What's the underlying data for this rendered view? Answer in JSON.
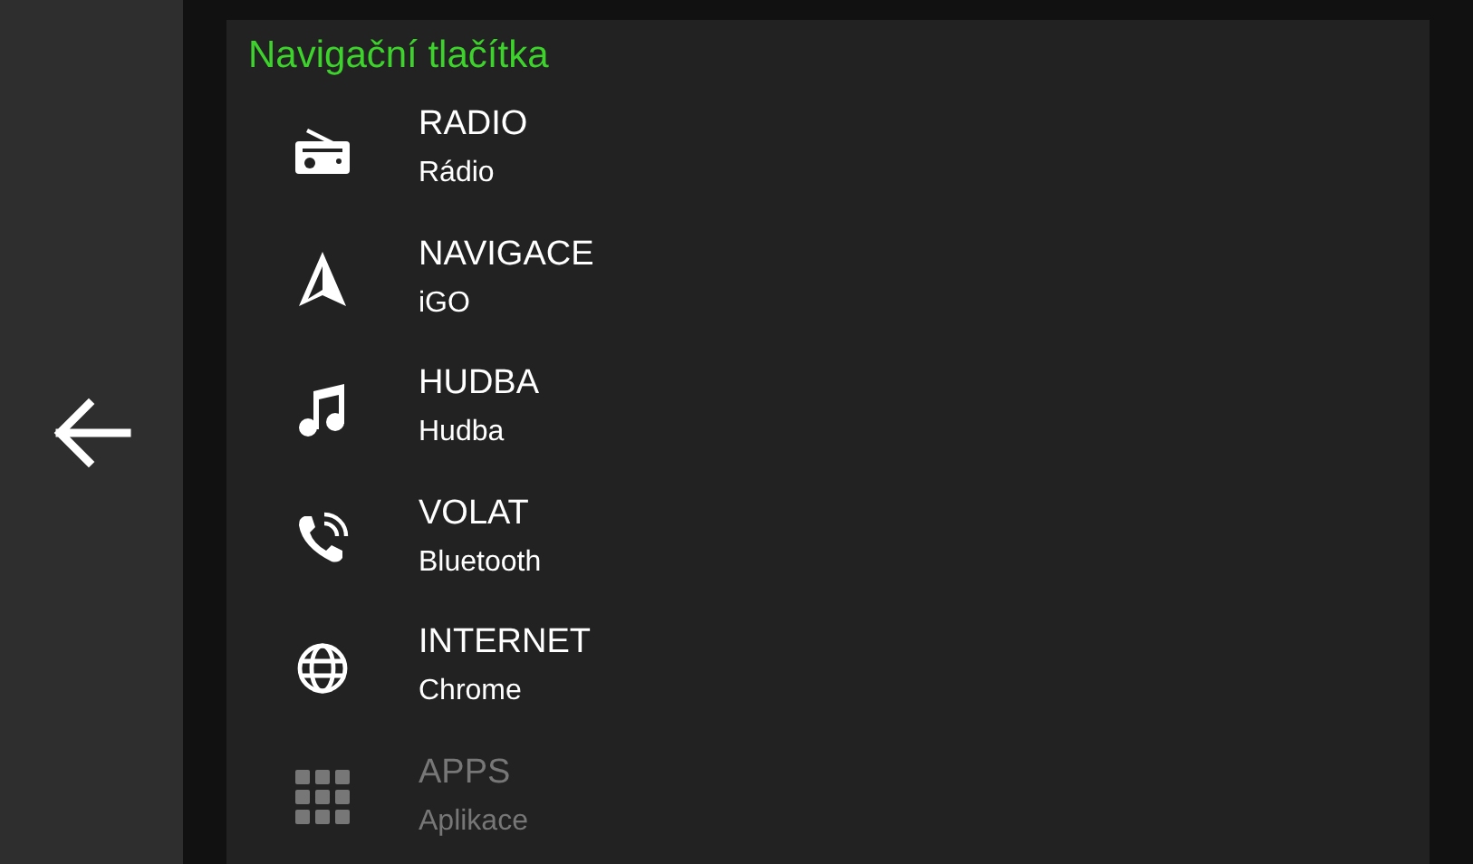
{
  "panel": {
    "title": "Navigační tlačítka"
  },
  "items": [
    {
      "kind": "radio",
      "label": "RADIO",
      "app": "Rádio",
      "disabled": false
    },
    {
      "kind": "navigation",
      "label": "NAVIGACE",
      "app": "iGO",
      "disabled": false
    },
    {
      "kind": "music",
      "label": "HUDBA",
      "app": "Hudba",
      "disabled": false
    },
    {
      "kind": "call",
      "label": "VOLAT",
      "app": "Bluetooth",
      "disabled": false
    },
    {
      "kind": "internet",
      "label": "INTERNET",
      "app": "Chrome",
      "disabled": false
    },
    {
      "kind": "apps",
      "label": "APPS",
      "app": "Aplikace",
      "disabled": true
    }
  ]
}
